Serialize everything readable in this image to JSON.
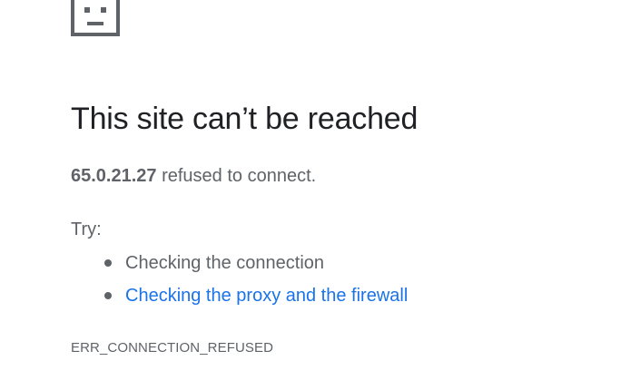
{
  "error_page": {
    "icon": "sad-page-icon",
    "title": "This site can’t be reached",
    "host": "65.0.21.27",
    "summary_suffix": " refused to connect.",
    "try_label": "Try:",
    "suggestions": [
      {
        "label": "Checking the connection",
        "is_link": false
      },
      {
        "label": "Checking the proxy and the firewall",
        "is_link": true
      }
    ],
    "error_code": "ERR_CONNECTION_REFUSED"
  },
  "colors": {
    "title_text": "#202124",
    "body_text": "#5f6368",
    "link": "#1a73e8"
  }
}
